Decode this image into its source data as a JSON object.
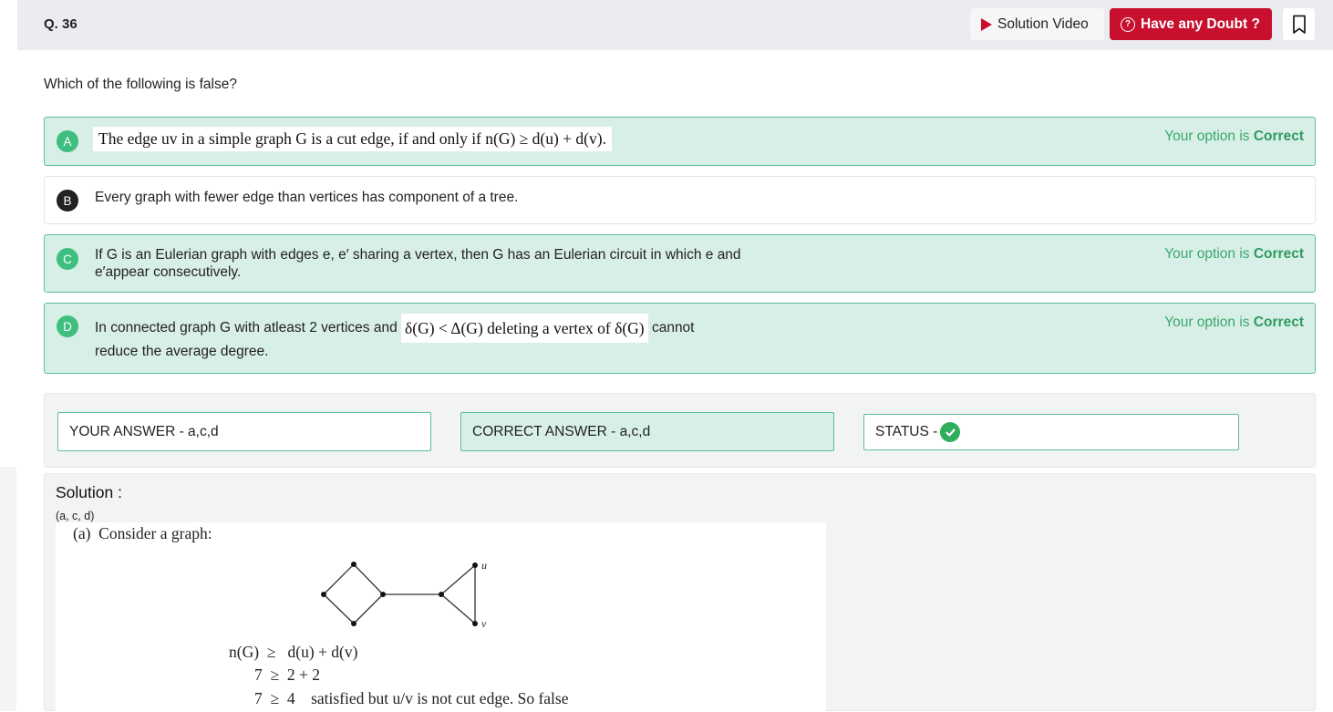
{
  "header": {
    "question_number": "Q. 36",
    "solution_video_label": "Solution Video",
    "doubt_label": "Have any Doubt ?"
  },
  "question": {
    "text": "Which of the following is false?"
  },
  "options": [
    {
      "letter": "A",
      "math_text": "The edge uv in a simple graph G is a cut edge, if and only if n(G) ≥ d(u) + d(v).",
      "verdict_prefix": "Your option is ",
      "verdict_word": "Correct",
      "selected": true
    },
    {
      "letter": "B",
      "text": "Every graph with fewer edge than vertices has component of a tree.",
      "selected": false
    },
    {
      "letter": "C",
      "text_line1": "If G is an Eulerian graph with edges e, e′ sharing a vertex, then G has an Eulerian circuit in which e and",
      "text_line2": "e′appear consecutively.",
      "verdict_prefix": "Your option is ",
      "verdict_word": "Correct",
      "selected": true
    },
    {
      "letter": "D",
      "text_before": "In connected graph G with atleast 2 vertices and ",
      "math_text": "δ(G) < Δ(G) deleting a vertex of δ(G)",
      "text_after": " cannot",
      "text_line2": "reduce the average degree.",
      "verdict_prefix": "Your option is ",
      "verdict_word": "Correct",
      "selected": true
    }
  ],
  "answers": {
    "your_answer": "YOUR ANSWER - a,c,d",
    "correct_answer": "CORRECT ANSWER - a,c,d",
    "status_label": "STATUS -"
  },
  "solution": {
    "title": "Solution :",
    "answer_line": "(a, c, d)",
    "intro": "(a)  Consider a graph:",
    "vertex_u": "u",
    "vertex_v": "v",
    "line1": "n(G)  ≥   d(u) + d(v)",
    "line2": "7  ≥  2 + 2",
    "line3": "7  ≥  4    satisfied but u/v is not cut edge. So false"
  },
  "colors": {
    "accent_red": "#c8102e",
    "correct_green": "#2f9a63",
    "correct_bg": "#d8efe7",
    "correct_border": "#5cbf93"
  }
}
